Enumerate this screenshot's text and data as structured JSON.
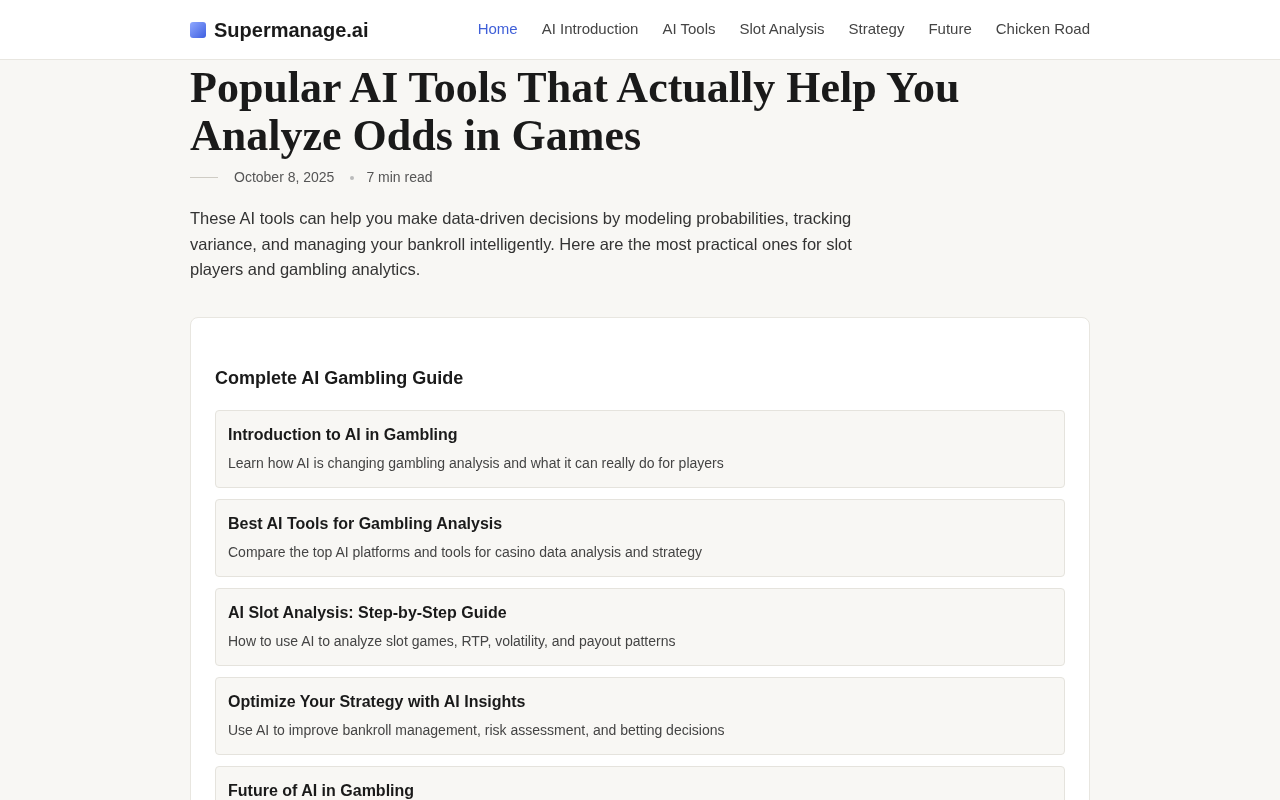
{
  "header": {
    "brand": "Supermanage.ai",
    "nav": [
      {
        "label": "Home",
        "selected": true
      },
      {
        "label": "AI Introduction",
        "selected": false
      },
      {
        "label": "AI Tools",
        "selected": false
      },
      {
        "label": "Slot Analysis",
        "selected": false
      },
      {
        "label": "Strategy",
        "selected": false
      },
      {
        "label": "Future",
        "selected": false
      },
      {
        "label": "Chicken Road",
        "selected": false
      }
    ]
  },
  "article": {
    "title": "Popular AI Tools That Actually Help You Analyze Odds in Games",
    "date": "October 8, 2025",
    "read_time": "7 min read",
    "intro": "These AI tools can help you make data-driven decisions by modeling probabilities, tracking variance, and managing your bankroll intelligently. Here are the most practical ones for slot players and gambling analytics."
  },
  "guide": {
    "title": "Complete AI Gambling Guide",
    "items": [
      {
        "title": "Introduction to AI in Gambling",
        "description": "Learn how AI is changing gambling analysis and what it can really do for players"
      },
      {
        "title": "Best AI Tools for Gambling Analysis",
        "description": "Compare the top AI platforms and tools for casino data analysis and strategy"
      },
      {
        "title": "AI Slot Analysis: Step-by-Step Guide",
        "description": "How to use AI to analyze slot games, RTP, volatility, and payout patterns"
      },
      {
        "title": "Optimize Your Strategy with AI Insights",
        "description": "Use AI to improve bankroll management, risk assessment, and betting decisions"
      },
      {
        "title": "Future of AI in Gambling"
      }
    ]
  }
}
